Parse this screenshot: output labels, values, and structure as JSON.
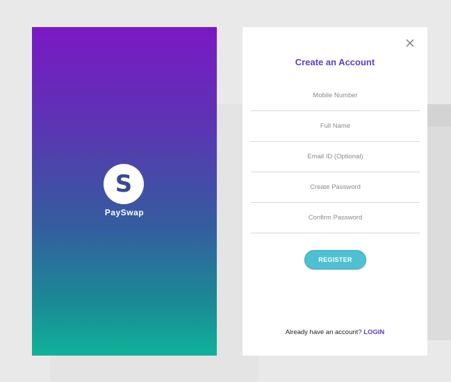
{
  "splash": {
    "logo_letter": "S",
    "brand_name": "PaySwap"
  },
  "form": {
    "close_icon": "close-icon",
    "title": "Create an Account",
    "fields": [
      {
        "placeholder": "Mobile Number",
        "value": ""
      },
      {
        "placeholder": "Full Name",
        "value": ""
      },
      {
        "placeholder": "Email ID (Optional)",
        "value": ""
      },
      {
        "placeholder": "Create Password",
        "value": ""
      },
      {
        "placeholder": "Confirm Password",
        "value": ""
      }
    ],
    "register_label": "REGISTER",
    "footer_text": "Already  have an account? ",
    "login_label": "LOGIN"
  },
  "colors": {
    "accent": "#5a3ec8",
    "button": "#4fc0d2",
    "gradient_top": "#7a18c4",
    "gradient_bottom": "#0fb39a"
  }
}
